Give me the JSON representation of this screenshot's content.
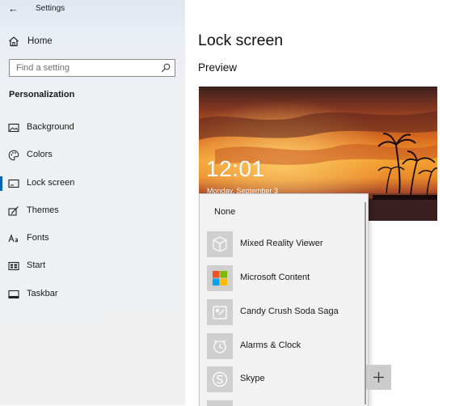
{
  "window": {
    "title": "Settings"
  },
  "sidebar": {
    "home_label": "Home",
    "search_placeholder": "Find a setting",
    "section_title": "Personalization",
    "items": [
      {
        "label": "Background",
        "icon": "picture-icon"
      },
      {
        "label": "Colors",
        "icon": "palette-icon"
      },
      {
        "label": "Lock screen",
        "icon": "lock-screen-icon",
        "active": true
      },
      {
        "label": "Themes",
        "icon": "brush-icon"
      },
      {
        "label": "Fonts",
        "icon": "fonts-icon"
      },
      {
        "label": "Start",
        "icon": "start-icon"
      },
      {
        "label": "Taskbar",
        "icon": "taskbar-icon"
      }
    ]
  },
  "main": {
    "title": "Lock screen",
    "preview_heading": "Preview",
    "preview": {
      "time": "12:01",
      "date": "Monday, September 3"
    }
  },
  "flyout": {
    "none_label": "None",
    "apps": [
      {
        "label": "Mixed Reality Viewer",
        "icon": "cube-icon"
      },
      {
        "label": "Microsoft Content",
        "icon": "microsoft-logo-icon"
      },
      {
        "label": "Candy Crush Soda Saga",
        "icon": "candy-crush-icon"
      },
      {
        "label": "Alarms & Clock",
        "icon": "alarm-clock-icon"
      },
      {
        "label": "Skype",
        "icon": "skype-icon"
      }
    ]
  },
  "colors": {
    "accent": "#0063b1"
  }
}
